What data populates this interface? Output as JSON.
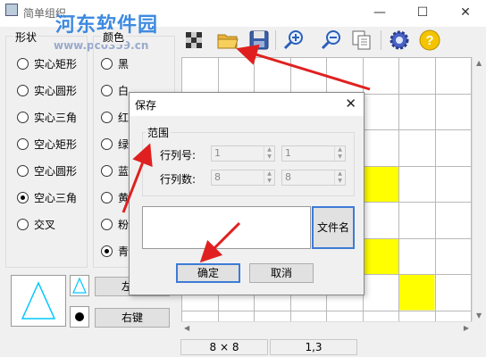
{
  "window": {
    "title": "简单组织",
    "minimize_glyph": "—",
    "maximize_glyph": "☐",
    "close_glyph": "✕"
  },
  "watermark": {
    "text": "河东软件园",
    "url": "www.pc0359.cn"
  },
  "toolbar": {
    "icons": [
      "checker-icon",
      "open-folder-icon",
      "save-disk-icon",
      "zoom-in-icon",
      "zoom-out-icon",
      "copy-icon",
      "settings-gear-icon",
      "help-icon"
    ]
  },
  "shape_group": {
    "label": "形状",
    "options": [
      "实心矩形",
      "实心圆形",
      "实心三角",
      "空心矩形",
      "空心圆形",
      "空心三角",
      "交叉"
    ],
    "selected": "空心三角"
  },
  "color_group": {
    "label": "颜色",
    "options": [
      "黑",
      "白",
      "红",
      "绿",
      "蓝",
      "黄",
      "粉",
      "青"
    ],
    "selected": "青"
  },
  "side_buttons": {
    "left_label": "左键",
    "right_label": "右键"
  },
  "grid": {
    "highlight_color": "#ffff00",
    "line_color": "#b9b9b9"
  },
  "status": {
    "size": "8 × 8",
    "position": "1,3"
  },
  "save_dialog": {
    "title": "保存",
    "close_glyph": "✕",
    "range_label": "范围",
    "row_col_label": "行列号:",
    "row_col_count_label": "行列数:",
    "row_value": "1",
    "col_value": "1",
    "rows_count": "8",
    "cols_count": "8",
    "filename_button": "文件名",
    "ok_button": "确定",
    "cancel_button": "取消"
  },
  "colors": {
    "accent": "#3d7bd6",
    "arrow": "#e02020",
    "cyan": "#00c8ff"
  }
}
